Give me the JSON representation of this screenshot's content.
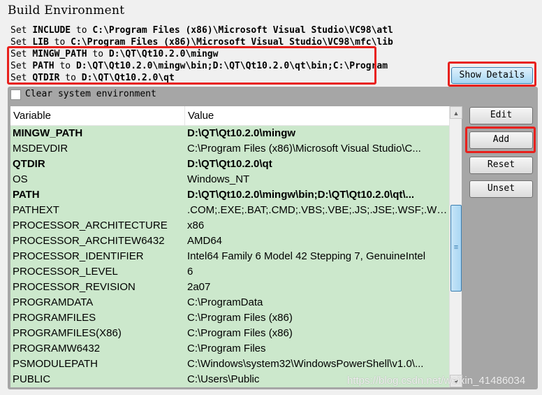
{
  "title": "Build Environment",
  "log": [
    {
      "pre": "Set ",
      "var": "INCLUDE",
      "mid": " to ",
      "val": "C:\\Program Files (x86)\\Microsoft Visual Studio\\VC98\\atl"
    },
    {
      "pre": "Set ",
      "var": "LIB",
      "mid": " to ",
      "val": "C:\\Program Files (x86)\\Microsoft Visual Studio\\VC98\\mfc\\lib"
    },
    {
      "pre": "Set ",
      "var": "MINGW_PATH",
      "mid": " to ",
      "val": "D:\\QT\\Qt10.2.0\\mingw"
    },
    {
      "pre": "Set ",
      "var": "PATH",
      "mid": " to ",
      "val": "D:\\QT\\Qt10.2.0\\mingw\\bin;D:\\QT\\Qt10.2.0\\qt\\bin;C:\\Program"
    },
    {
      "pre": "Set ",
      "var": "QTDIR",
      "mid": " to ",
      "val": "D:\\QT\\Qt10.2.0\\qt"
    }
  ],
  "show_details": "Show Details",
  "clear_env": "Clear system environment",
  "clear_env_checked": false,
  "table": {
    "headers": [
      "Variable",
      "Value"
    ],
    "rows": [
      {
        "var": "MINGW_PATH",
        "val": "D:\\QT\\Qt10.2.0\\mingw",
        "bold": true
      },
      {
        "var": "MSDEVDIR",
        "val": "C:\\Program Files (x86)\\Microsoft Visual Studio\\C...",
        "bold": false
      },
      {
        "var": "QTDIR",
        "val": "D:\\QT\\Qt10.2.0\\qt",
        "bold": true
      },
      {
        "var": "OS",
        "val": "Windows_NT",
        "bold": false
      },
      {
        "var": "PATH",
        "val": "D:\\QT\\Qt10.2.0\\mingw\\bin;D:\\QT\\Qt10.2.0\\qt\\...",
        "bold": true
      },
      {
        "var": "PATHEXT",
        "val": ".COM;.EXE;.BAT;.CMD;.VBS;.VBE;.JS;.JSE;.WSF;.WS...",
        "bold": false
      },
      {
        "var": "PROCESSOR_ARCHITECTURE",
        "val": "x86",
        "bold": false
      },
      {
        "var": "PROCESSOR_ARCHITEW6432",
        "val": "AMD64",
        "bold": false
      },
      {
        "var": "PROCESSOR_IDENTIFIER",
        "val": "Intel64 Family 6 Model 42 Stepping 7, GenuineIntel",
        "bold": false
      },
      {
        "var": "PROCESSOR_LEVEL",
        "val": "6",
        "bold": false
      },
      {
        "var": "PROCESSOR_REVISION",
        "val": "2a07",
        "bold": false
      },
      {
        "var": "PROGRAMDATA",
        "val": "C:\\ProgramData",
        "bold": false
      },
      {
        "var": "PROGRAMFILES",
        "val": "C:\\Program Files (x86)",
        "bold": false
      },
      {
        "var": "PROGRAMFILES(X86)",
        "val": "C:\\Program Files (x86)",
        "bold": false
      },
      {
        "var": "PROGRAMW6432",
        "val": "C:\\Program Files",
        "bold": false
      },
      {
        "var": "PSMODULEPATH",
        "val": "C:\\Windows\\system32\\WindowsPowerShell\\v1.0\\...",
        "bold": false
      },
      {
        "var": "PUBLIC",
        "val": "C:\\Users\\Public",
        "bold": false
      }
    ]
  },
  "buttons": {
    "edit": "Edit",
    "add": "Add",
    "reset": "Reset",
    "unset": "Unset"
  },
  "watermark": "https://blog.csdn.net/weixin_41486034",
  "colors": {
    "highlight": "#e8201c",
    "row_bg": "#cce8cc",
    "panel": "#a6a6a6"
  }
}
